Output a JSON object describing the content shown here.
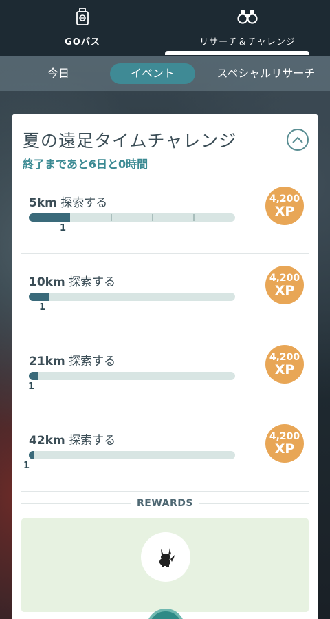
{
  "top_tabs": {
    "go_pass": "GOパス",
    "research": "リサーチ＆チャレンジ"
  },
  "sub_tabs": {
    "today": "今日",
    "event": "イベント",
    "special": "スペシャルリサーチ"
  },
  "challenge": {
    "title": "夏の遠足タイムチャレンジ",
    "time_left": "終了まであと6日と0時間",
    "tasks": [
      {
        "distance": "5km",
        "action": "探索する",
        "progress": "1",
        "progress_fraction": 0.2,
        "xp_amount": "4,200",
        "xp_unit": "XP"
      },
      {
        "distance": "10km",
        "action": "探索する",
        "progress": "1",
        "progress_fraction": 0.1,
        "xp_amount": "4,200",
        "xp_unit": "XP"
      },
      {
        "distance": "21km",
        "action": "探索する",
        "progress": "1",
        "progress_fraction": 0.048,
        "xp_amount": "4,200",
        "xp_unit": "XP"
      },
      {
        "distance": "42km",
        "action": "探索する",
        "progress": "1",
        "progress_fraction": 0.024,
        "xp_amount": "4,200",
        "xp_unit": "XP"
      }
    ]
  },
  "rewards": {
    "label": "REWARDS",
    "item_icon": "pikachu-silhouette-icon"
  },
  "colors": {
    "accent": "#3f8a95",
    "xp_badge": "#e8a656",
    "progress_fill": "#3a6a7a",
    "progress_track": "#d8e5e3",
    "rewards_bg": "#e7f2e1"
  }
}
